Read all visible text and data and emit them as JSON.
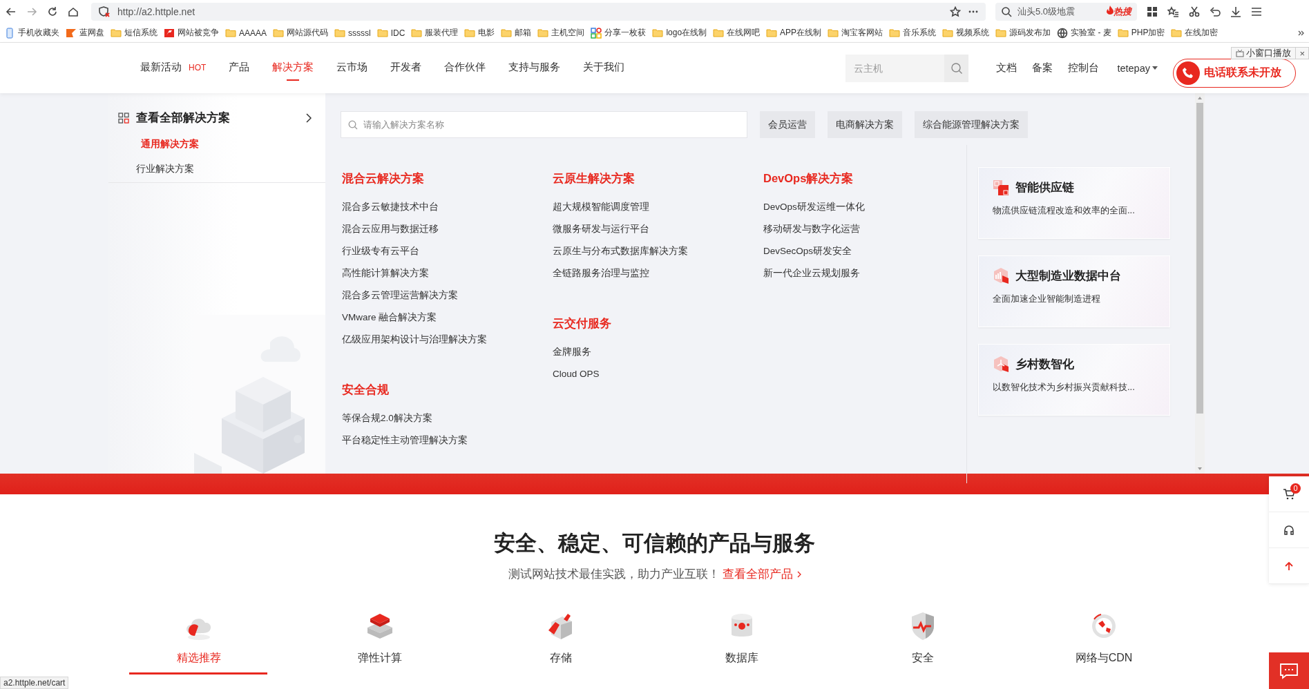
{
  "browser": {
    "url": "http://a2.httple.net",
    "search": {
      "value": "汕头5.0级地震",
      "badge": "热搜"
    }
  },
  "bookmarks": [
    {
      "label": "手机收藏夹",
      "kind": "phone"
    },
    {
      "label": "蓝网盘",
      "kind": "flag"
    },
    {
      "label": "短信系统",
      "kind": "folder"
    },
    {
      "label": "网站被竞争",
      "kind": "site"
    },
    {
      "label": "AAAAA",
      "kind": "folder"
    },
    {
      "label": "网站源代码",
      "kind": "folder"
    },
    {
      "label": "sssssl",
      "kind": "folder"
    },
    {
      "label": "IDC",
      "kind": "folder"
    },
    {
      "label": "服装代理",
      "kind": "folder"
    },
    {
      "label": "电影",
      "kind": "folder"
    },
    {
      "label": "邮箱",
      "kind": "folder"
    },
    {
      "label": "主机空间",
      "kind": "folder"
    },
    {
      "label": "分享一枚获",
      "kind": "tiles"
    },
    {
      "label": "logo在线制",
      "kind": "folder"
    },
    {
      "label": "在线网吧",
      "kind": "folder"
    },
    {
      "label": "APP在线制",
      "kind": "folder"
    },
    {
      "label": "淘宝客网站",
      "kind": "folder"
    },
    {
      "label": "音乐系统",
      "kind": "folder"
    },
    {
      "label": "视频系统",
      "kind": "folder"
    },
    {
      "label": "源码发布加",
      "kind": "folder"
    },
    {
      "label": "实验室 - 麦",
      "kind": "globe"
    },
    {
      "label": "PHP加密",
      "kind": "folder"
    },
    {
      "label": "在线加密",
      "kind": "folder"
    }
  ],
  "header": {
    "nav": [
      {
        "label": "最新活动",
        "badge": "HOT",
        "selected": false
      },
      {
        "label": "产品",
        "selected": false
      },
      {
        "label": "解决方案",
        "selected": true
      },
      {
        "label": "云市场",
        "selected": false
      },
      {
        "label": "开发者",
        "selected": false
      },
      {
        "label": "合作伙伴",
        "selected": false
      },
      {
        "label": "支持与服务",
        "selected": false
      },
      {
        "label": "关于我们",
        "selected": false
      }
    ],
    "search": {
      "placeholder": "云主机"
    },
    "links": [
      "文档",
      "备案",
      "控制台"
    ],
    "account": "tetepay",
    "phone_button": "电话联系未开放"
  },
  "mini_player": {
    "label": "小窗口播放",
    "close": "×"
  },
  "solutions_menu": {
    "all_link": "查看全部解决方案",
    "categories": [
      {
        "label": "通用解决方案",
        "selected": true
      },
      {
        "label": "行业解决方案",
        "selected": false
      }
    ],
    "search": {
      "placeholder": "请输入解决方案名称"
    },
    "tags": [
      "会员运营",
      "电商解决方案",
      "综合能源管理解决方案"
    ],
    "columns": [
      [
        {
          "title": "混合云解决方案",
          "items": [
            "混合多云敏捷技术中台",
            "混合云应用与数据迁移",
            "行业级专有云平台",
            "高性能计算解决方案",
            "混合多云管理运营解决方案",
            "VMware 融合解决方案",
            "亿级应用架构设计与治理解决方案"
          ]
        },
        {
          "title": "安全合规",
          "items": [
            "等保合规2.0解决方案",
            "平台稳定性主动管理解决方案"
          ]
        }
      ],
      [
        {
          "title": "云原生解决方案",
          "items": [
            "超大规模智能调度管理",
            "微服务研发与运行平台",
            "云原生与分布式数据库解决方案",
            "全链路服务治理与监控"
          ]
        },
        {
          "title": "云交付服务",
          "items": [
            "金牌服务",
            "Cloud OPS"
          ]
        }
      ],
      [
        {
          "title": "DevOps解决方案",
          "items": [
            "DevOps研发运维一体化",
            "移动研发与数字化运营",
            "DevSecOps研发安全",
            "新一代企业云规划服务"
          ]
        }
      ]
    ],
    "cards": [
      {
        "title": "智能供应链",
        "description": "物流供应链流程改造和效率的全面..."
      },
      {
        "title": "大型制造业数据中台",
        "description": "全面加速企业智能制造进程"
      },
      {
        "title": "乡村数智化",
        "description": "以数智化技术为乡村振兴贡献科技..."
      }
    ]
  },
  "products": {
    "title": "安全、稳定、可信赖的产品与服务",
    "subtitle": "测试网站技术最佳实践，助力产业互联！",
    "link": "查看全部产品",
    "tabs": [
      {
        "label": "精选推荐",
        "selected": true
      },
      {
        "label": "弹性计算",
        "selected": false
      },
      {
        "label": "存储",
        "selected": false
      },
      {
        "label": "数据库",
        "selected": false
      },
      {
        "label": "安全",
        "selected": false
      },
      {
        "label": "网络与CDN",
        "selected": false
      }
    ]
  },
  "float_bar": {
    "cart_count": "0"
  },
  "status_url": "a2.httple.net/cart"
}
